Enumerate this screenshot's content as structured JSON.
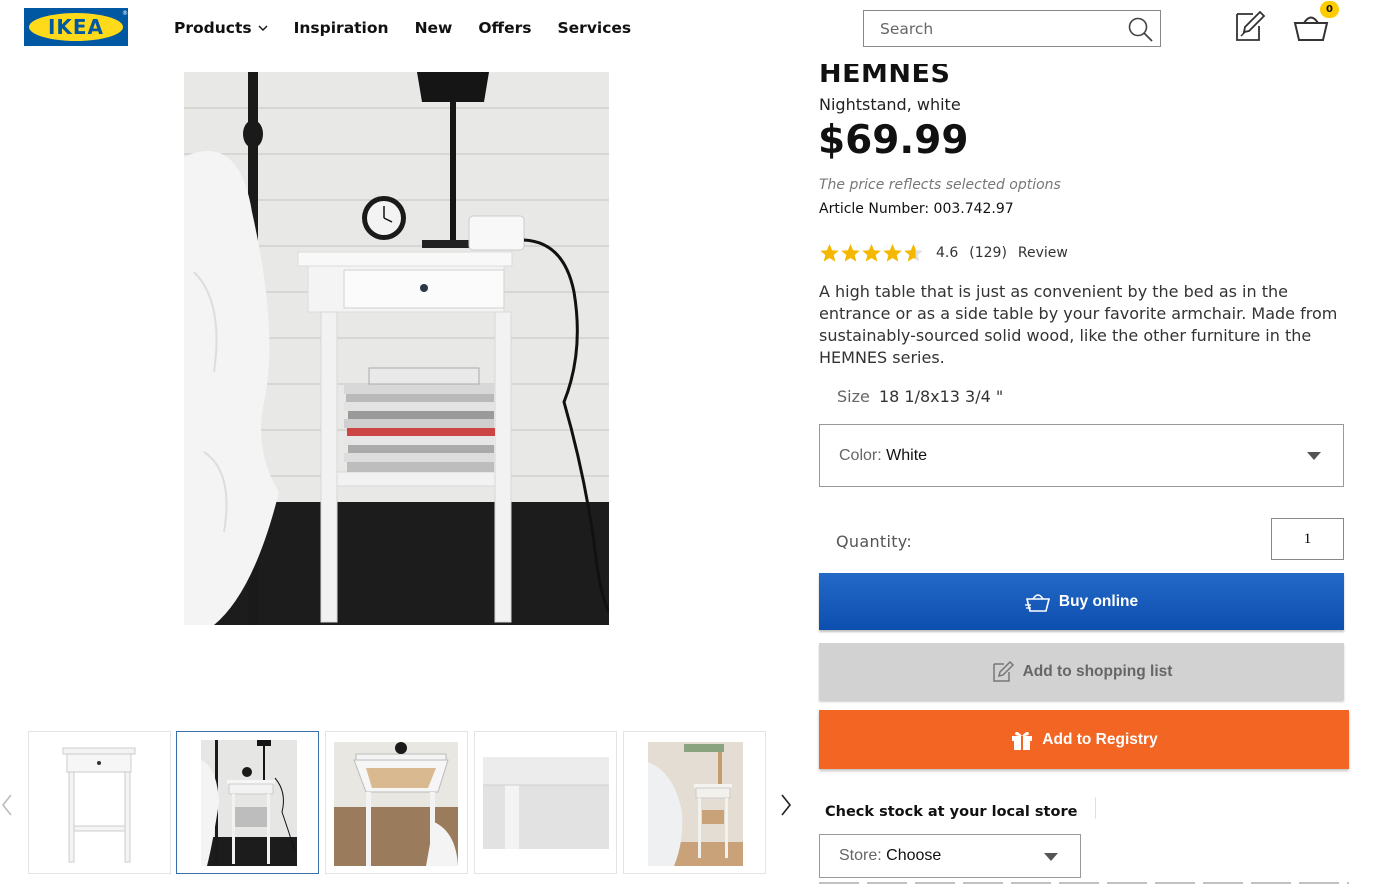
{
  "header": {
    "logo_text": "IKEA",
    "logo_mark": "®",
    "nav": [
      {
        "label": "Products",
        "has_dropdown": true
      },
      {
        "label": "Inspiration"
      },
      {
        "label": "New"
      },
      {
        "label": "Offers"
      },
      {
        "label": "Services"
      }
    ],
    "search_placeholder": "Search",
    "cart_count": "0",
    "colors": {
      "logo_blue": "#0058a3",
      "logo_yellow": "#ffda1a",
      "badge_yellow": "#ffcc00"
    }
  },
  "product": {
    "name": "HEMNES",
    "subtitle": "Nightstand, white",
    "price": "$69.99",
    "price_note": "The price reflects selected options",
    "article_label": "Article Number:",
    "article_number": "003.742.97",
    "rating": {
      "value": "4.6",
      "stars": 4.6,
      "count": "(129)",
      "review_label": "Review"
    },
    "description": "A high table that is just as convenient by the bed as in the entrance or as a side table by your favorite armchair. Made from sustainably-sourced solid wood, like the other furniture in the HEMNES series.",
    "size_label": "Size",
    "size_value": "18 1/8x13 3/4 \"",
    "color_label": "Color:",
    "color_value": "White",
    "quantity_label": "Quantity:",
    "quantity_value": "1"
  },
  "actions": {
    "buy_online": "Buy online",
    "add_to_list": "Add to shopping list",
    "add_to_registry": "Add to Registry",
    "colors": {
      "buy": "#0d56b8",
      "list": "#d2d2d2",
      "registry": "#f26522"
    }
  },
  "store": {
    "check_stock_title": "Check stock at your local store",
    "store_label": "Store:",
    "store_value": "Choose"
  },
  "gallery": {
    "thumbnails": [
      {
        "name": "nightstand-front"
      },
      {
        "name": "nightstand-bedroom",
        "active": true
      },
      {
        "name": "nightstand-drawer-open"
      },
      {
        "name": "nightstand-detail"
      },
      {
        "name": "nightstand-room"
      }
    ]
  }
}
